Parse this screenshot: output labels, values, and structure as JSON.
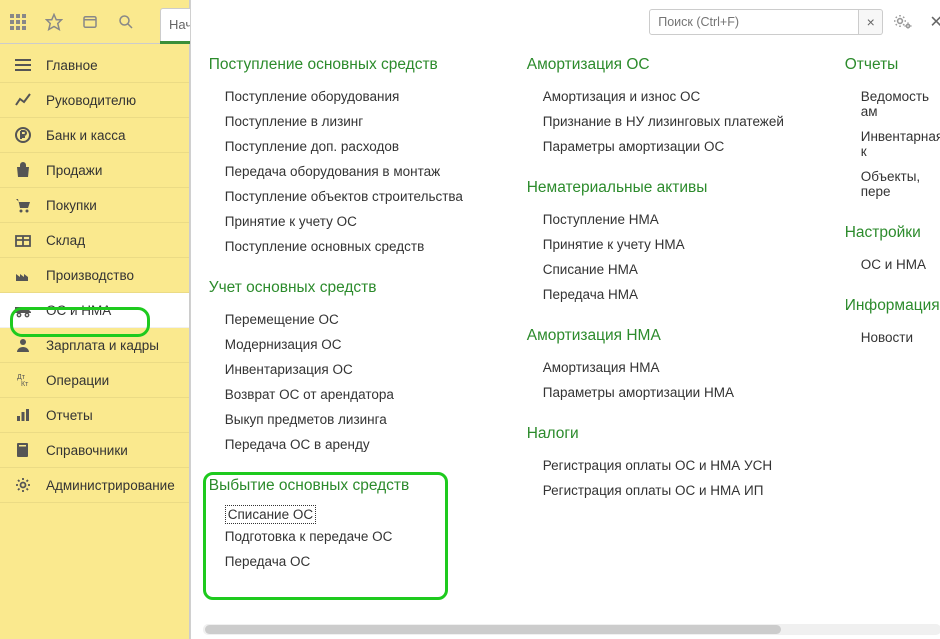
{
  "search": {
    "placeholder": "Поиск (Ctrl+F)"
  },
  "tab_partial": "Нач",
  "nav": {
    "items": [
      {
        "label": "Главное",
        "icon": "menu"
      },
      {
        "label": "Руководителю",
        "icon": "chart"
      },
      {
        "label": "Банк и касса",
        "icon": "ruble"
      },
      {
        "label": "Продажи",
        "icon": "bag"
      },
      {
        "label": "Покупки",
        "icon": "cart"
      },
      {
        "label": "Склад",
        "icon": "box"
      },
      {
        "label": "Производство",
        "icon": "factory"
      },
      {
        "label": "ОС и НМА",
        "icon": "truck"
      },
      {
        "label": "Зарплата и кадры",
        "icon": "person"
      },
      {
        "label": "Операции",
        "icon": "ops"
      },
      {
        "label": "Отчеты",
        "icon": "report"
      },
      {
        "label": "Справочники",
        "icon": "book"
      },
      {
        "label": "Администрирование",
        "icon": "gear"
      }
    ]
  },
  "columns": {
    "col1": [
      {
        "title": "Поступление основных средств",
        "links": [
          "Поступление оборудования",
          "Поступление в лизинг",
          "Поступление доп. расходов",
          "Передача оборудования в монтаж",
          "Поступление объектов строительства",
          "Принятие к учету ОС",
          "Поступление основных средств"
        ]
      },
      {
        "title": "Учет основных средств",
        "links": [
          "Перемещение ОС",
          "Модернизация ОС",
          "Инвентаризация ОС",
          "Возврат ОС от арендатора",
          "Выкуп предметов лизинга",
          "Передача ОС в аренду"
        ]
      },
      {
        "title": "Выбытие основных средств",
        "links": [
          "Списание ОС",
          "Подготовка к передаче ОС",
          "Передача ОС"
        ]
      }
    ],
    "col2": [
      {
        "title": "Амортизация ОС",
        "links": [
          "Амортизация и износ ОС",
          "Признание в НУ лизинговых платежей",
          "Параметры амортизации ОС"
        ]
      },
      {
        "title": "Нематериальные активы",
        "links": [
          "Поступление НМА",
          "Принятие к учету НМА",
          "Списание НМА",
          "Передача НМА"
        ]
      },
      {
        "title": "Амортизация НМА",
        "links": [
          "Амортизация НМА",
          "Параметры амортизации НМА"
        ]
      },
      {
        "title": "Налоги",
        "links": [
          "Регистрация оплаты ОС и НМА УСН",
          "Регистрация оплаты ОС и НМА ИП"
        ]
      }
    ],
    "col3": [
      {
        "title": "Отчеты",
        "links": [
          "Ведомость ам",
          "Инвентарная к",
          "Объекты, пере"
        ]
      },
      {
        "title": "Настройки",
        "links": [
          "ОС и НМА"
        ]
      },
      {
        "title": "Информация",
        "links": [
          "Новости"
        ]
      }
    ]
  }
}
